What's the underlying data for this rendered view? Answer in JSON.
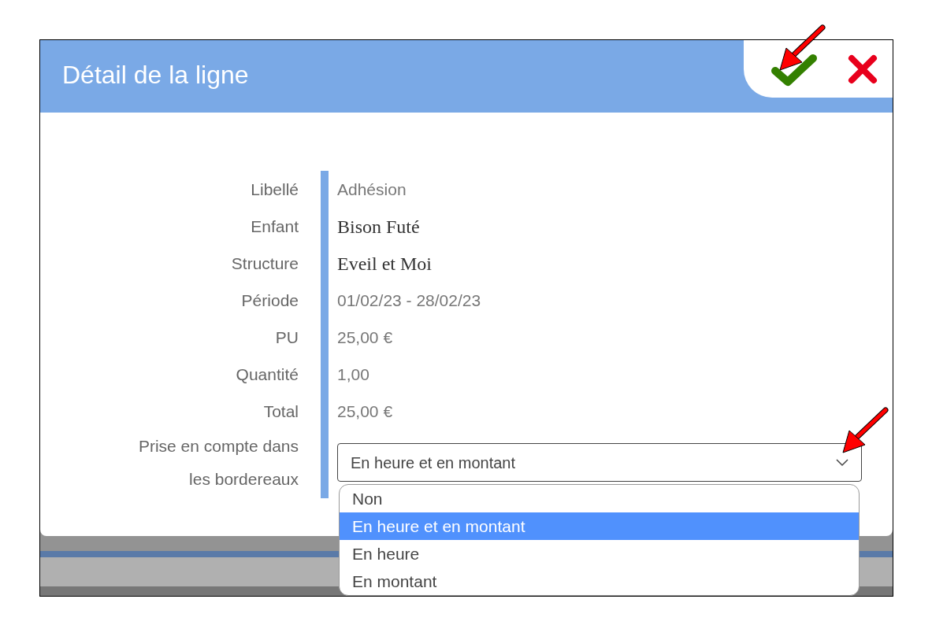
{
  "dialog": {
    "title": "Détail de la ligne"
  },
  "fields": [
    {
      "label": "Libellé",
      "value": "Adhésion",
      "kind": "text"
    },
    {
      "label": "Enfant",
      "value": "Bison Futé",
      "kind": "serif"
    },
    {
      "label": "Structure",
      "value": "Eveil et Moi",
      "kind": "serif"
    },
    {
      "label": "Période",
      "value": "01/02/23 - 28/02/23",
      "kind": "text"
    },
    {
      "label": "PU",
      "value": "25,00 €",
      "kind": "text"
    },
    {
      "label": "Quantité",
      "value": "1,00",
      "kind": "text"
    },
    {
      "label": "Total",
      "value": "25,00 €",
      "kind": "text"
    }
  ],
  "select": {
    "label_lines": [
      "Prise en compte dans",
      "les bordereaux"
    ],
    "value": "En heure et en montant",
    "expanded": true,
    "options": [
      {
        "label": "Non",
        "selected": false
      },
      {
        "label": "En heure et en montant",
        "selected": true
      },
      {
        "label": "En heure",
        "selected": false
      },
      {
        "label": "En montant",
        "selected": false
      }
    ]
  }
}
